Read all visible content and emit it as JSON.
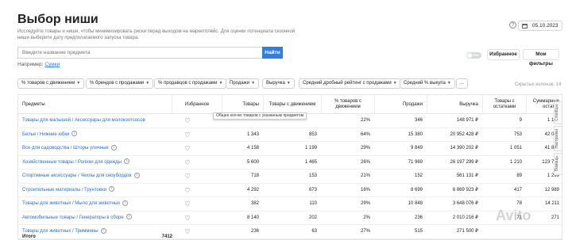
{
  "header": {
    "title": "Выбор ниши",
    "subtitle": "Исследуйте товары и ниши, чтобы минимизировать риски перед выходом на маркетплейс. Для оценки потенциала сезонной ниши выберите дату предполагаемого запуска товара.",
    "help": "?",
    "date": "05.10.2023"
  },
  "search": {
    "placeholder": "Введите название предмета",
    "button": "Найти",
    "example_prefix": "Например:",
    "example_link": "Сумки"
  },
  "actions": {
    "toggle_label": "FBS",
    "favorites": "Избранное",
    "my_filters": "Мои фильтры"
  },
  "filters": [
    "% товаров с движением",
    "% брендов с продажами",
    "% продавцов с продажами",
    "Продажи",
    "Выручка",
    "Средний дробный рейтинг с продажами",
    "Средний % выкупа",
    "..."
  ],
  "hidden_columns": "Скрытых колонок: 14",
  "table": {
    "columns": [
      "Предметы",
      "Избранное",
      "Товары",
      "Товары с движением",
      "% товаров с движением",
      "Продажи",
      "Выручка",
      "Товары с остатками",
      "Суммарные остатки"
    ],
    "rows": [
      {
        "name": "Товары для малышей / Аксессуары для молокоотсосов",
        "info": false,
        "products": "",
        "moving": "",
        "pct": "22%",
        "sales": "346",
        "revenue": "148 971 ₽",
        "with_stock": "9",
        "stock": "1 193"
      },
      {
        "name": "Белье / Нижние юбки",
        "info": true,
        "products": "1 343",
        "moving": "853",
        "pct": "64%",
        "sales": "15 380",
        "revenue": "20 952 428 ₽",
        "with_stock": "753",
        "stock": "42 048"
      },
      {
        "name": "Все для садоводства / Шторы уличные",
        "info": true,
        "products": "4 158",
        "moving": "1 199",
        "pct": "29%",
        "sales": "9 849",
        "revenue": "14 390 202 ₽",
        "with_stock": "1 051",
        "stock": "41 876"
      },
      {
        "name": "Хозяйственные товары / Ролики для одежды",
        "info": true,
        "products": "5 600",
        "moving": "1 465",
        "pct": "26%",
        "sales": "71 969",
        "revenue": "26 197 299 ₽",
        "with_stock": "1 210",
        "stock": "123 732"
      },
      {
        "name": "Спортивные аксессуары / Чехлы для сноубордов",
        "info": true,
        "products": "718",
        "moving": "153",
        "pct": "21%",
        "sales": "152",
        "revenue": "561 131 ₽",
        "with_stock": "89",
        "stock": "1 299"
      },
      {
        "name": "Строительные материалы / Грунтовки",
        "info": true,
        "products": "4 292",
        "moving": "673",
        "pct": "16%",
        "sales": "8 699",
        "revenue": "6 869 923 ₽",
        "with_stock": "417",
        "stock": "12 989"
      },
      {
        "name": "Товары для животных / Мыло для животных",
        "info": true,
        "products": "382",
        "moving": "110",
        "pct": "29%",
        "sales": "10 848",
        "revenue": "3 648 076 ₽",
        "with_stock": "78",
        "stock": "14 211"
      },
      {
        "name": "Автомобильные товары / Генераторы в сборе",
        "info": true,
        "products": "8 140",
        "moving": "202",
        "pct": "2%",
        "sales": "236",
        "revenue": "2 010 216 ₽",
        "with_stock": "71",
        "stock": "271"
      },
      {
        "name": "Товары для животных / Триммины",
        "info": true,
        "products": "236",
        "moving": "63",
        "pct": "27%",
        "sales": "515",
        "revenue": "271 500 ₽",
        "with_stock": "",
        "stock": ""
      }
    ],
    "total_label": "Итого",
    "total_value": "7412"
  },
  "tooltip": "Общее кол-во товаров с указанным предметом",
  "side_tabs": [
    "Столбцы",
    "Настройки",
    "Помощь"
  ],
  "watermark": "Avito"
}
